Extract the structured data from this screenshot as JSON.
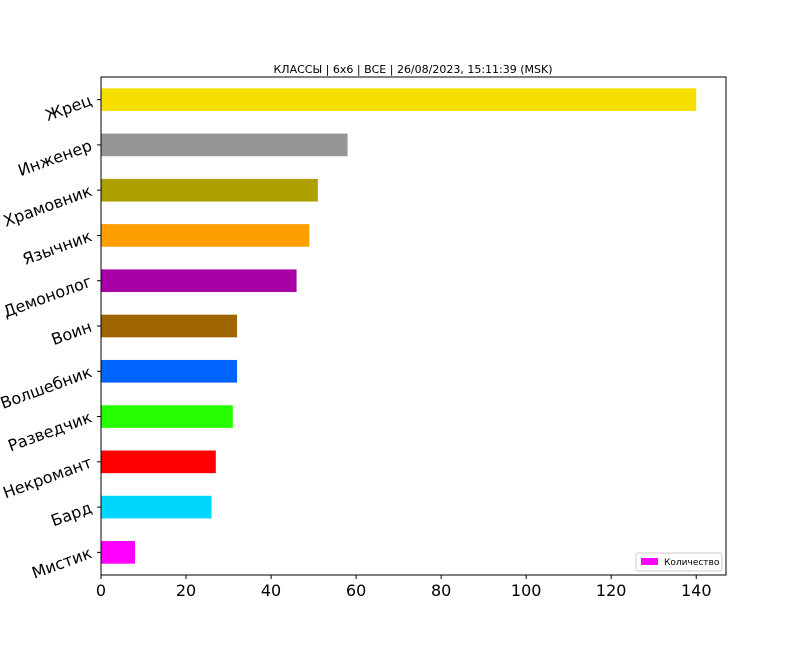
{
  "chart_data": {
    "type": "bar",
    "orientation": "horizontal",
    "title": "КЛАССЫ | 6x6 | ВСЕ | 26/08/2023, 15:11:39 (MSK)",
    "categories": [
      "Жрец",
      "Инженер",
      "Храмовник",
      "Язычник",
      "Демонолог",
      "Воин",
      "Волшебник",
      "Разведчик",
      "Некромант",
      "Бард",
      "Мистик"
    ],
    "values": [
      140,
      58,
      51,
      49,
      46,
      32,
      32,
      31,
      27,
      26,
      8
    ],
    "colors": [
      "#f7e000",
      "#969696",
      "#ad9f00",
      "#ff9e00",
      "#a600a6",
      "#9e6400",
      "#0064ff",
      "#26ff00",
      "#ff0000",
      "#00d6ff",
      "#ff00ff"
    ],
    "series": [
      {
        "name": "Количество"
      }
    ],
    "legend_color": "#ff00ff",
    "legend_position": "lower-right",
    "xlim": [
      0,
      147
    ],
    "xticks": [
      0,
      20,
      40,
      60,
      80,
      100,
      120,
      140
    ],
    "xlabel": "",
    "ylabel": "",
    "grid": false
  }
}
